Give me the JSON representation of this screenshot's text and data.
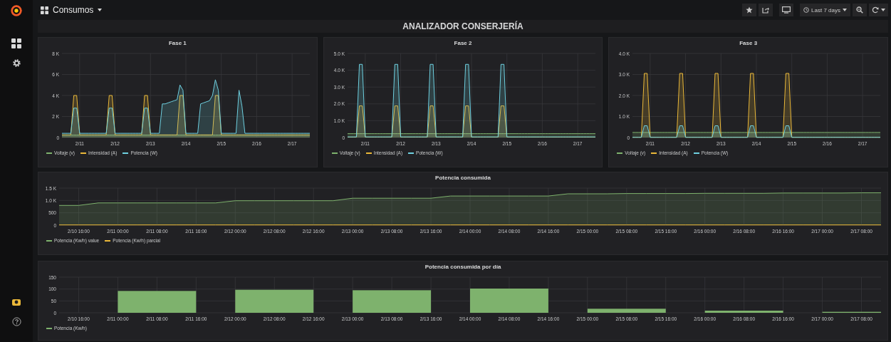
{
  "dashboard": {
    "title": "Consumos",
    "time_range": "Last 7 days"
  },
  "row_title": "ANALIZADOR CONSERJERÍA",
  "rows": [
    [
      {
        "chart_data": {
          "type": "area",
          "title": "Fase 1",
          "grid": true,
          "ylim": [
            0,
            8000
          ],
          "categories": [
            null,
            null,
            null,
            null,
            null,
            null,
            "2/11",
            null,
            null,
            null,
            null,
            null,
            null,
            null,
            null,
            null,
            null,
            null,
            "2/12",
            null,
            null,
            null,
            null,
            null,
            null,
            null,
            null,
            null,
            null,
            null,
            "2/13",
            null,
            null,
            null,
            null,
            null,
            null,
            null,
            null,
            null,
            null,
            null,
            "2/14",
            null,
            null,
            null,
            null,
            null,
            null,
            null,
            null,
            null,
            null,
            null,
            "2/15",
            null,
            null,
            null,
            null,
            null,
            null,
            null,
            null,
            null,
            null,
            null,
            "2/16",
            null,
            null,
            null,
            null,
            null,
            null,
            null,
            null,
            null,
            null,
            null,
            "2/17",
            null,
            null,
            null,
            null,
            null,
            null
          ],
          "yticks": [
            0,
            {
              "value": 2000,
              "label": "2 K"
            },
            {
              "value": 4000,
              "label": "4 K"
            },
            {
              "value": 6000,
              "label": "6 K"
            },
            {
              "value": 8000,
              "label": "8 K"
            }
          ],
          "series": [
            {
              "name": "Voltaje (v)",
              "color": "#7eb26d",
              "values": [
                230,
                230,
                230,
                230,
                230,
                230,
                230,
                230,
                230,
                230,
                230,
                230,
                230,
                230,
                230,
                230,
                230,
                230,
                230,
                230,
                230,
                230,
                230,
                230,
                230,
                230,
                230,
                230,
                230,
                230,
                230,
                230,
                230,
                230,
                230,
                230,
                230,
                230,
                230,
                230,
                230,
                230,
                230,
                230,
                230,
                230,
                230,
                230,
                230,
                230,
                230,
                230,
                230,
                230,
                230,
                230,
                230,
                230,
                230,
                230,
                230,
                230,
                230,
                230,
                230,
                230,
                230,
                230,
                230,
                230,
                230,
                230,
                230,
                230,
                230,
                230,
                230,
                230,
                230,
                230,
                230,
                230,
                230,
                230,
                230
              ]
            },
            {
              "name": "Intensidad (A)",
              "color": "#eab839",
              "values": [
                250,
                250,
                250,
                250,
                4000,
                4000,
                250,
                250,
                250,
                250,
                250,
                250,
                250,
                250,
                250,
                250,
                4000,
                4000,
                250,
                250,
                250,
                250,
                250,
                250,
                250,
                250,
                250,
                250,
                4000,
                4000,
                250,
                250,
                250,
                250,
                250,
                250,
                250,
                250,
                250,
                250,
                4000,
                4000,
                250,
                250,
                250,
                250,
                250,
                250,
                250,
                250,
                250,
                250,
                4000,
                4000,
                250,
                250,
                250,
                250,
                250,
                250,
                250,
                250,
                250,
                250,
                250,
                250,
                250,
                250,
                250,
                250,
                250,
                250,
                250,
                250,
                250,
                250,
                250,
                250,
                250,
                250,
                250,
                250,
                250,
                250,
                250
              ]
            },
            {
              "name": "Potencia (W)",
              "color": "#6ed0e0",
              "values": [
                400,
                400,
                400,
                400,
                2800,
                2800,
                400,
                400,
                400,
                400,
                400,
                400,
                400,
                400,
                400,
                400,
                2800,
                2800,
                400,
                400,
                400,
                400,
                400,
                400,
                400,
                400,
                400,
                400,
                2800,
                2800,
                400,
                400,
                400,
                400,
                3200,
                3200,
                3300,
                3400,
                3500,
                3600,
                5000,
                4500,
                400,
                400,
                400,
                400,
                400,
                3200,
                3300,
                3400,
                3500,
                4000,
                5500,
                4500,
                400,
                400,
                400,
                400,
                400,
                400,
                4500,
                3000,
                400,
                400,
                400,
                400,
                400,
                400,
                400,
                400,
                400,
                400,
                400,
                400,
                400,
                400,
                400,
                400,
                400,
                400,
                400,
                400,
                400,
                400,
                400
              ]
            }
          ]
        }
      },
      {
        "chart_data": {
          "type": "area",
          "title": "Fase 2",
          "grid": true,
          "ylim": [
            0,
            5000
          ],
          "categories": [
            null,
            null,
            null,
            null,
            null,
            null,
            "2/11",
            null,
            null,
            null,
            null,
            null,
            null,
            null,
            null,
            null,
            null,
            null,
            "2/12",
            null,
            null,
            null,
            null,
            null,
            null,
            null,
            null,
            null,
            null,
            null,
            "2/13",
            null,
            null,
            null,
            null,
            null,
            null,
            null,
            null,
            null,
            null,
            null,
            "2/14",
            null,
            null,
            null,
            null,
            null,
            null,
            null,
            null,
            null,
            null,
            null,
            "2/15",
            null,
            null,
            null,
            null,
            null,
            null,
            null,
            null,
            null,
            null,
            null,
            "2/16",
            null,
            null,
            null,
            null,
            null,
            null,
            null,
            null,
            null,
            null,
            null,
            "2/17",
            null,
            null,
            null,
            null,
            null,
            null
          ],
          "yticks": [
            0,
            {
              "value": 1000,
              "label": "1.0 K"
            },
            {
              "value": 2000,
              "label": "2.0 K"
            },
            {
              "value": 3000,
              "label": "3.0 K"
            },
            {
              "value": 4000,
              "label": "4.0 K"
            },
            {
              "value": 5000,
              "label": "5.0 K"
            }
          ],
          "series": [
            {
              "name": "Voltaje (v)",
              "color": "#7eb26d",
              "values": [
                230,
                230,
                230,
                230,
                230,
                230,
                230,
                230,
                230,
                230,
                230,
                230,
                230,
                230,
                230,
                230,
                230,
                230,
                230,
                230,
                230,
                230,
                230,
                230,
                230,
                230,
                230,
                230,
                230,
                230,
                230,
                230,
                230,
                230,
                230,
                230,
                230,
                230,
                230,
                230,
                230,
                230,
                230,
                230,
                230,
                230,
                230,
                230,
                230,
                230,
                230,
                230,
                230,
                230,
                230,
                230,
                230,
                230,
                230,
                230,
                230,
                230,
                230,
                230,
                230,
                230,
                230,
                230,
                230,
                230,
                230,
                230,
                230,
                230,
                230,
                230,
                230,
                230,
                230,
                230,
                230,
                230,
                230,
                230,
                230
              ]
            },
            {
              "name": "Intensidad (A)",
              "color": "#eab839",
              "values": [
                20,
                20,
                20,
                20,
                1880,
                1880,
                20,
                20,
                20,
                20,
                20,
                20,
                20,
                20,
                20,
                20,
                1880,
                1880,
                20,
                20,
                20,
                20,
                20,
                20,
                20,
                20,
                20,
                20,
                1880,
                1880,
                20,
                20,
                20,
                20,
                20,
                20,
                20,
                20,
                20,
                20,
                1880,
                1880,
                20,
                20,
                20,
                20,
                20,
                20,
                20,
                20,
                20,
                20,
                1880,
                1880,
                20,
                20,
                20,
                20,
                20,
                20,
                20,
                20,
                20,
                20,
                20,
                20,
                20,
                20,
                20,
                20,
                20,
                20,
                20,
                20,
                20,
                20,
                20,
                20,
                20,
                20,
                20,
                20,
                20,
                20,
                20
              ]
            },
            {
              "name": "Potencia (W)",
              "color": "#6ed0e0",
              "values": [
                40,
                40,
                40,
                40,
                4350,
                4350,
                40,
                40,
                40,
                40,
                40,
                40,
                40,
                40,
                40,
                40,
                4350,
                4350,
                40,
                40,
                40,
                40,
                40,
                40,
                40,
                40,
                40,
                40,
                4350,
                4350,
                40,
                40,
                40,
                40,
                40,
                40,
                40,
                40,
                40,
                40,
                4350,
                4350,
                40,
                40,
                40,
                40,
                40,
                40,
                40,
                40,
                40,
                40,
                4350,
                4350,
                40,
                40,
                40,
                40,
                40,
                40,
                40,
                40,
                40,
                40,
                40,
                40,
                40,
                40,
                40,
                40,
                40,
                40,
                40,
                40,
                40,
                40,
                40,
                40,
                40,
                40,
                40,
                40,
                40,
                40,
                40
              ]
            }
          ]
        }
      },
      {
        "chart_data": {
          "type": "area",
          "title": "Fase 3",
          "grid": true,
          "ylim": [
            0,
            4000
          ],
          "categories": [
            null,
            null,
            null,
            null,
            null,
            null,
            "2/11",
            null,
            null,
            null,
            null,
            null,
            null,
            null,
            null,
            null,
            null,
            null,
            "2/12",
            null,
            null,
            null,
            null,
            null,
            null,
            null,
            null,
            null,
            null,
            null,
            "2/13",
            null,
            null,
            null,
            null,
            null,
            null,
            null,
            null,
            null,
            null,
            null,
            "2/14",
            null,
            null,
            null,
            null,
            null,
            null,
            null,
            null,
            null,
            null,
            null,
            "2/15",
            null,
            null,
            null,
            null,
            null,
            null,
            null,
            null,
            null,
            null,
            null,
            "2/16",
            null,
            null,
            null,
            null,
            null,
            null,
            null,
            null,
            null,
            null,
            null,
            "2/17",
            null,
            null,
            null,
            null,
            null,
            null
          ],
          "yticks": [
            0,
            {
              "value": 1000,
              "label": "1.0 K"
            },
            {
              "value": 2000,
              "label": "2.0 K"
            },
            {
              "value": 3000,
              "label": "3.0 K"
            },
            {
              "value": 4000,
              "label": "4.0 K"
            }
          ],
          "series": [
            {
              "name": "Voltaje (v)",
              "color": "#7eb26d",
              "values": [
                240,
                240,
                240,
                240,
                240,
                240,
                240,
                240,
                240,
                240,
                240,
                240,
                240,
                240,
                240,
                240,
                240,
                240,
                240,
                240,
                240,
                240,
                240,
                240,
                240,
                240,
                240,
                240,
                240,
                240,
                240,
                240,
                240,
                240,
                240,
                240,
                240,
                240,
                240,
                240,
                240,
                240,
                240,
                240,
                240,
                240,
                240,
                240,
                240,
                240,
                240,
                240,
                240,
                240,
                240,
                240,
                240,
                240,
                240,
                240,
                240,
                240,
                240,
                240,
                240,
                240,
                240,
                240,
                240,
                240,
                240,
                240,
                240,
                240,
                240,
                240,
                240,
                240,
                240,
                240,
                240,
                240,
                240,
                240,
                240
              ]
            },
            {
              "name": "Intensidad (A)",
              "color": "#eab839",
              "values": [
                10,
                10,
                10,
                10,
                3050,
                3050,
                10,
                10,
                10,
                10,
                10,
                10,
                10,
                10,
                10,
                10,
                3050,
                3050,
                10,
                10,
                10,
                10,
                10,
                10,
                10,
                10,
                10,
                10,
                3050,
                3050,
                10,
                10,
                10,
                10,
                10,
                10,
                10,
                10,
                10,
                10,
                3050,
                3050,
                10,
                10,
                10,
                10,
                10,
                10,
                10,
                10,
                10,
                10,
                3050,
                3050,
                10,
                10,
                10,
                10,
                10,
                10,
                10,
                10,
                10,
                10,
                10,
                10,
                10,
                10,
                10,
                10,
                10,
                10,
                10,
                10,
                10,
                10,
                10,
                10,
                10,
                10,
                10,
                10,
                10,
                10,
                10
              ]
            },
            {
              "name": "Potencia (W)",
              "color": "#6ed0e0",
              "values": [
                10,
                10,
                10,
                10,
                560,
                560,
                10,
                10,
                10,
                10,
                10,
                10,
                10,
                10,
                10,
                10,
                560,
                560,
                10,
                10,
                10,
                10,
                10,
                10,
                10,
                10,
                10,
                10,
                560,
                560,
                10,
                10,
                10,
                10,
                10,
                10,
                10,
                10,
                10,
                10,
                560,
                560,
                10,
                10,
                10,
                10,
                10,
                10,
                10,
                10,
                10,
                10,
                560,
                560,
                10,
                10,
                10,
                10,
                10,
                10,
                10,
                10,
                10,
                10,
                10,
                10,
                10,
                10,
                10,
                10,
                10,
                10,
                10,
                10,
                10,
                10,
                10,
                10,
                10,
                10,
                10,
                10,
                10,
                10,
                10
              ]
            }
          ]
        }
      }
    ],
    [
      {
        "chart_data": {
          "type": "area",
          "title": "Potencia consumida",
          "grid": true,
          "ylim": [
            0,
            1500
          ],
          "categories": [
            null,
            "2/10 16:00",
            null,
            "2/11 00:00",
            null,
            "2/11 08:00",
            null,
            "2/11 16:00",
            null,
            "2/12 00:00",
            null,
            "2/12 08:00",
            null,
            "2/12 16:00",
            null,
            "2/13 00:00",
            null,
            "2/13 08:00",
            null,
            "2/13 16:00",
            null,
            "2/14 00:00",
            null,
            "2/14 08:00",
            null,
            "2/14 16:00",
            null,
            "2/15 00:00",
            null,
            "2/15 08:00",
            null,
            "2/15 16:00",
            null,
            "2/16 00:00",
            null,
            "2/16 08:00",
            null,
            "2/16 16:00",
            null,
            "2/17 00:00",
            null,
            "2/17 08:00",
            null
          ],
          "yticks": [
            0,
            500,
            {
              "value": 1000,
              "label": "1.0 K"
            },
            {
              "value": 1500,
              "label": "1.5 K"
            }
          ],
          "series": [
            {
              "name": "Potencia (Kw/h) value",
              "color": "#7eb26d",
              "values": [
                800,
                800,
                900,
                900,
                900,
                900,
                900,
                900,
                900,
                990,
                990,
                990,
                990,
                990,
                990,
                1090,
                1090,
                1090,
                1090,
                1090,
                1180,
                1180,
                1180,
                1180,
                1180,
                1180,
                1270,
                1270,
                1270,
                1280,
                1280,
                1280,
                1280,
                1290,
                1290,
                1290,
                1290,
                1300,
                1300,
                1300,
                1300,
                1310,
                1310
              ]
            },
            {
              "name": "Potencia (Kw/h) parcial",
              "color": "#eab839",
              "values": [
                10,
                10,
                10,
                10,
                10,
                10,
                10,
                10,
                10,
                10,
                10,
                10,
                10,
                10,
                10,
                10,
                10,
                10,
                10,
                10,
                10,
                10,
                10,
                10,
                10,
                10,
                10,
                10,
                10,
                10,
                10,
                10,
                10,
                10,
                10,
                10,
                10,
                10,
                10,
                10,
                10,
                10,
                10
              ]
            }
          ]
        }
      }
    ],
    [
      {
        "chart_data": {
          "type": "bar",
          "title": "Potencia consumida por día",
          "grid": true,
          "ylim": [
            0,
            150
          ],
          "categories": [
            "2/10 16:00",
            "2/11 00:00",
            "2/11 08:00",
            "2/11 16:00",
            "2/12 00:00",
            "2/12 08:00",
            "2/12 16:00",
            "2/13 00:00",
            "2/13 08:00",
            "2/13 16:00",
            "2/14 00:00",
            "2/14 08:00",
            "2/14 16:00",
            "2/15 00:00",
            "2/15 08:00",
            "2/15 16:00",
            "2/16 00:00",
            "2/16 08:00",
            "2/16 16:00",
            "2/17 00:00",
            "2/17 08:00"
          ],
          "yticks": [
            0,
            50,
            100,
            150
          ],
          "series": [
            {
              "name": "Potencia (Kw/h)",
              "color": "#7eb26d",
              "values": [
                null,
                null,
                92,
                null,
                null,
                97,
                null,
                null,
                95,
                null,
                null,
                102,
                null,
                null,
                17,
                null,
                null,
                9,
                null,
                null,
                4
              ]
            }
          ]
        }
      }
    ]
  ]
}
